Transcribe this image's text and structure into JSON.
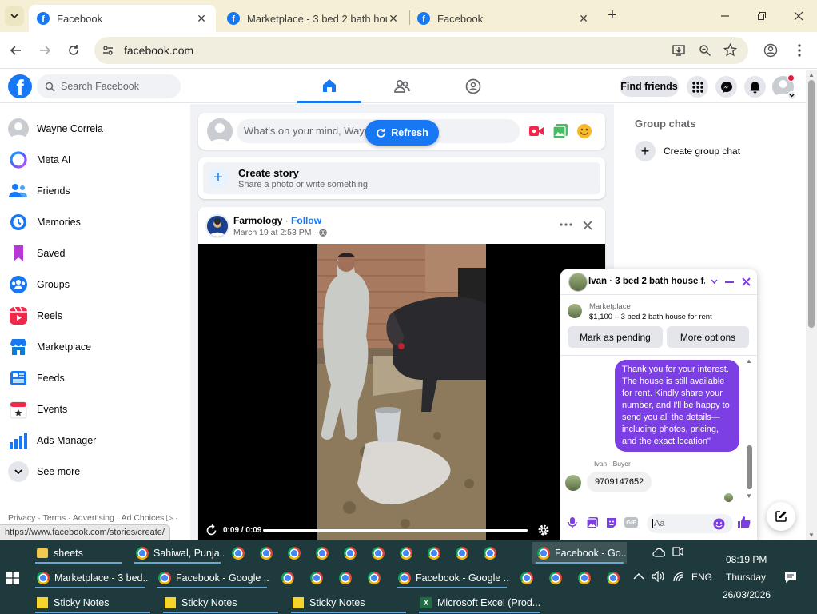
{
  "browser": {
    "tabs": [
      {
        "title": "Facebook",
        "active": true
      },
      {
        "title": "Marketplace - 3 bed 2 bath hou",
        "active": false
      },
      {
        "title": "Facebook",
        "active": false
      }
    ],
    "url": "facebook.com",
    "status_url": "https://www.facebook.com/stories/create/"
  },
  "fb": {
    "search_placeholder": "Search Facebook",
    "find_friends": "Find friends"
  },
  "sidebar": {
    "items": [
      {
        "label": "Wayne Correia",
        "icon": "avatar"
      },
      {
        "label": "Meta AI",
        "icon": "meta-ai-icon"
      },
      {
        "label": "Friends",
        "icon": "friends-icon"
      },
      {
        "label": "Memories",
        "icon": "memories-icon"
      },
      {
        "label": "Saved",
        "icon": "saved-icon"
      },
      {
        "label": "Groups",
        "icon": "groups-icon"
      },
      {
        "label": "Reels",
        "icon": "reels-icon"
      },
      {
        "label": "Marketplace",
        "icon": "marketplace-icon"
      },
      {
        "label": "Feeds",
        "icon": "feeds-icon"
      },
      {
        "label": "Events",
        "icon": "events-icon"
      },
      {
        "label": "Ads Manager",
        "icon": "ads-manager-icon"
      },
      {
        "label": "See more",
        "icon": "chevron-down-icon"
      }
    ],
    "footer": "Privacy · Terms · Advertising · Ad Choices ▷ ·"
  },
  "composer": {
    "placeholder": "What's on your mind, Wayn",
    "refresh": "Refresh"
  },
  "story": {
    "title": "Create story",
    "subtitle": "Share a photo or write something."
  },
  "post": {
    "author": "Farmology",
    "follow": "Follow",
    "time": "March 19 at 2:53 PM",
    "video_time": "0:09 / 0:09",
    "progress": 1.0
  },
  "right": {
    "group_chats": "Group chats",
    "create_group": "Create group chat"
  },
  "chat": {
    "title": "Ivan · 3 bed 2 bath house f...",
    "market_label": "Marketplace",
    "listing": "$1,100 – 3 bed 2 bath house for rent",
    "mark_pending": "Mark as pending",
    "more_options": "More options",
    "sent_message": "Thank you for your interest. The house is still available for rent. Kindly share your number, and I'll be happy to send you all the details—including photos, pricing, and the exact location\"",
    "buyer_label": "Ivan · Buyer",
    "buyer_message": "9709147652",
    "input_placeholder": "Aa"
  },
  "taskbar": {
    "row1": [
      {
        "label": "sheets",
        "icon": "folder"
      },
      {
        "label": "Sahiwal, Punja...",
        "icon": "chrome"
      },
      {
        "label": "Facebook - Go...",
        "icon": "chrome"
      }
    ],
    "row2": [
      {
        "label": "Marketplace - 3 bed...",
        "icon": "chrome"
      },
      {
        "label": "Facebook - Google ...",
        "icon": "chrome"
      },
      {
        "label": "Facebook - Google ...",
        "icon": "chrome"
      }
    ],
    "row3": [
      {
        "label": "Sticky Notes",
        "icon": "sticky"
      },
      {
        "label": "Sticky Notes",
        "icon": "sticky"
      },
      {
        "label": "Sticky Notes",
        "icon": "sticky"
      },
      {
        "label": "Microsoft Excel (Prod...",
        "icon": "excel"
      }
    ],
    "time": "08:19 PM",
    "day": "Thursday",
    "date": "26/03/2026",
    "lang": "ENG"
  },
  "colors": {
    "fb_blue": "#1877f2",
    "messenger_purple": "#7b3fe4",
    "taskbar": "#1f3a3d",
    "tab_strip": "#f5f0d5"
  }
}
